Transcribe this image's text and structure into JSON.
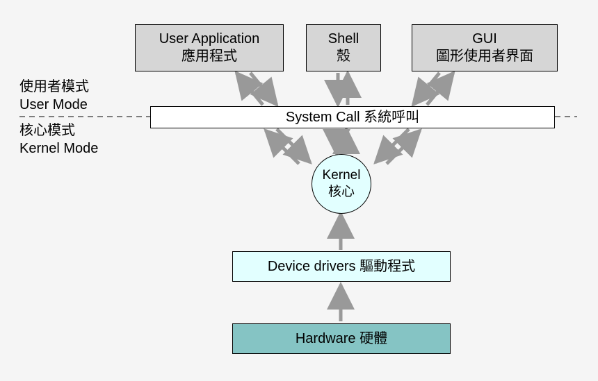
{
  "top": {
    "userApp": {
      "en": "User Application",
      "zh": "應用程式"
    },
    "shell": {
      "en": "Shell",
      "zh": "殼"
    },
    "gui": {
      "en": "GUI",
      "zh": "圖形使用者界面"
    }
  },
  "sideLabels": {
    "userMode": {
      "zh": "使用者模式",
      "en": "User Mode"
    },
    "kernelMode": {
      "zh": "核心模式",
      "en": "Kernel Mode"
    }
  },
  "systemCall": "System Call 系統呼叫",
  "kernel": {
    "en": "Kernel",
    "zh": "核心"
  },
  "drivers": "Device drivers 驅動程式",
  "hardware": "Hardware 硬體",
  "colors": {
    "topBox": "#d6d6d6",
    "syscall": "#ffffff",
    "kernel": "#e2ffff",
    "drivers": "#e2ffff",
    "hardware": "#85c4c4",
    "arrow": "#999999"
  },
  "structure": {
    "description": "OS layered architecture diagram. Dashed line separates User Mode from Kernel Mode at the System Call boundary.",
    "layers": [
      "User Applications / Shell / GUI",
      "System Call",
      "Kernel",
      "Device drivers",
      "Hardware"
    ],
    "arrows": [
      {
        "from": "User Application",
        "to": "System Call",
        "bidirectional": true
      },
      {
        "from": "Shell",
        "to": "System Call",
        "bidirectional": true
      },
      {
        "from": "GUI",
        "to": "System Call",
        "bidirectional": true
      },
      {
        "from": "System Call",
        "to": "Kernel",
        "bidirectional": true,
        "count": 3
      },
      {
        "from": "Device drivers",
        "to": "Kernel",
        "bidirectional": false
      },
      {
        "from": "Hardware",
        "to": "Device drivers",
        "bidirectional": false
      }
    ]
  }
}
